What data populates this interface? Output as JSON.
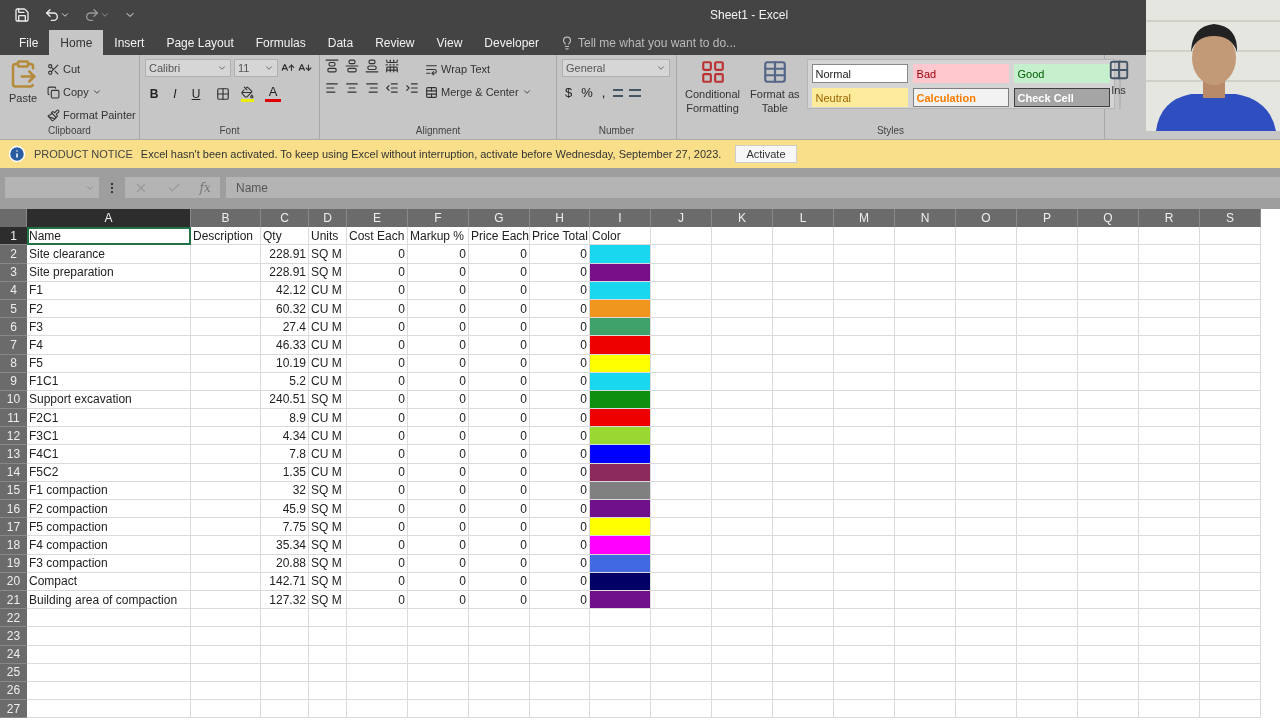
{
  "window": {
    "title": "Sheet1 - Excel"
  },
  "tabs": [
    {
      "label": "File",
      "selected": false
    },
    {
      "label": "Home",
      "selected": true
    },
    {
      "label": "Insert",
      "selected": false
    },
    {
      "label": "Page Layout",
      "selected": false
    },
    {
      "label": "Formulas",
      "selected": false
    },
    {
      "label": "Data",
      "selected": false
    },
    {
      "label": "Review",
      "selected": false
    },
    {
      "label": "View",
      "selected": false
    },
    {
      "label": "Developer",
      "selected": false
    }
  ],
  "search": {
    "placeholder": "Tell me what you want to do..."
  },
  "ribbon": {
    "clipboard": {
      "label": "Clipboard",
      "paste": "Paste",
      "cut": "Cut",
      "copy": "Copy",
      "format_painter": "Format Painter"
    },
    "font": {
      "label": "Font",
      "name": "Calibri",
      "size": "11",
      "bold": "B",
      "italic": "I",
      "underline": "U",
      "font_color": "A"
    },
    "alignment": {
      "label": "Alignment",
      "wrap": "Wrap Text",
      "merge": "Merge & Center"
    },
    "number": {
      "label": "Number",
      "format": "General",
      "currency": "$",
      "percent": "%",
      "comma": ","
    },
    "styles": {
      "label": "Styles",
      "conditional": [
        "Conditional",
        "Formatting"
      ],
      "format_table": [
        "Format as",
        "Table"
      ],
      "gallery": [
        {
          "label": "Normal",
          "kind": "normal"
        },
        {
          "label": "Bad",
          "kind": "bad"
        },
        {
          "label": "Good",
          "kind": "good"
        },
        {
          "label": "Neutral",
          "kind": "neutral"
        },
        {
          "label": "Calculation",
          "kind": "calculation"
        },
        {
          "label": "Check Cell",
          "kind": "check"
        }
      ]
    },
    "cells": {
      "insert": "Ins"
    }
  },
  "notice": {
    "title": "PRODUCT NOTICE",
    "message": "Excel hasn't been activated. To keep using Excel without interruption, activate before Wednesday, September 27, 2023.",
    "button": "Activate"
  },
  "formula_bar": {
    "fx_label": "fx",
    "value": "Name"
  },
  "columns": [
    {
      "label": "A",
      "selected": true
    },
    {
      "label": "B",
      "selected": false
    },
    {
      "label": "C",
      "selected": false
    },
    {
      "label": "D",
      "selected": false
    },
    {
      "label": "E",
      "selected": false
    },
    {
      "label": "F",
      "selected": false
    },
    {
      "label": "G",
      "selected": false
    },
    {
      "label": "H",
      "selected": false
    },
    {
      "label": "I",
      "selected": false
    },
    {
      "label": "J",
      "selected": false
    },
    {
      "label": "K",
      "selected": false
    },
    {
      "label": "L",
      "selected": false
    },
    {
      "label": "M",
      "selected": false
    },
    {
      "label": "N",
      "selected": false
    },
    {
      "label": "O",
      "selected": false
    },
    {
      "label": "P",
      "selected": false
    },
    {
      "label": "Q",
      "selected": false
    },
    {
      "label": "R",
      "selected": false
    },
    {
      "label": "S",
      "selected": false
    }
  ],
  "header_row": {
    "number": "1",
    "selected": true,
    "cells": [
      "Name",
      "Description",
      "Qty",
      "Units",
      "Cost Each",
      "Markup %",
      "Price Each",
      "Price Total",
      "Color"
    ]
  },
  "rows": [
    {
      "number": "2",
      "name": "Site clearance",
      "qty": "228.91",
      "units": "SQ M",
      "cost": "0",
      "markup": "0",
      "price_each": "0",
      "price_total": "0",
      "color": "#1ad7f0"
    },
    {
      "number": "3",
      "name": "Site preparation",
      "qty": "228.91",
      "units": "SQ M",
      "cost": "0",
      "markup": "0",
      "price_each": "0",
      "price_total": "0",
      "color": "#760f88"
    },
    {
      "number": "4",
      "name": "F1",
      "qty": "42.12",
      "units": "CU M",
      "cost": "0",
      "markup": "0",
      "price_each": "0",
      "price_total": "0",
      "color": "#1ad7f0"
    },
    {
      "number": "5",
      "name": "F2",
      "qty": "60.32",
      "units": "CU M",
      "cost": "0",
      "markup": "0",
      "price_each": "0",
      "price_total": "0",
      "color": "#f0961e"
    },
    {
      "number": "6",
      "name": "F3",
      "qty": "27.4",
      "units": "CU M",
      "cost": "0",
      "markup": "0",
      "price_each": "0",
      "price_total": "0",
      "color": "#3fa26a"
    },
    {
      "number": "7",
      "name": "F4",
      "qty": "46.33",
      "units": "CU M",
      "cost": "0",
      "markup": "0",
      "price_each": "0",
      "price_total": "0",
      "color": "#ee0000"
    },
    {
      "number": "8",
      "name": "F5",
      "qty": "10.19",
      "units": "CU M",
      "cost": "0",
      "markup": "0",
      "price_each": "0",
      "price_total": "0",
      "color": "#ffff00"
    },
    {
      "number": "9",
      "name": "F1C1",
      "qty": "5.2",
      "units": "CU M",
      "cost": "0",
      "markup": "0",
      "price_each": "0",
      "price_total": "0",
      "color": "#1ad7f0"
    },
    {
      "number": "10",
      "name": "Support excavation",
      "qty": "240.51",
      "units": "SQ M",
      "cost": "0",
      "markup": "0",
      "price_each": "0",
      "price_total": "0",
      "color": "#0f8f10"
    },
    {
      "number": "11",
      "name": "F2C1",
      "qty": "8.9",
      "units": "CU M",
      "cost": "0",
      "markup": "0",
      "price_each": "0",
      "price_total": "0",
      "color": "#ee0000"
    },
    {
      "number": "12",
      "name": "F3C1",
      "qty": "4.34",
      "units": "CU M",
      "cost": "0",
      "markup": "0",
      "price_each": "0",
      "price_total": "0",
      "color": "#98d830"
    },
    {
      "number": "13",
      "name": "F4C1",
      "qty": "7.8",
      "units": "CU M",
      "cost": "0",
      "markup": "0",
      "price_each": "0",
      "price_total": "0",
      "color": "#0000ff"
    },
    {
      "number": "14",
      "name": "F5C2",
      "qty": "1.35",
      "units": "CU M",
      "cost": "0",
      "markup": "0",
      "price_each": "0",
      "price_total": "0",
      "color": "#8c2a5e"
    },
    {
      "number": "15",
      "name": "F1 compaction",
      "qty": "32",
      "units": "SQ M",
      "cost": "0",
      "markup": "0",
      "price_each": "0",
      "price_total": "0",
      "color": "#808080"
    },
    {
      "number": "16",
      "name": "F2 compaction",
      "qty": "45.9",
      "units": "SQ M",
      "cost": "0",
      "markup": "0",
      "price_each": "0",
      "price_total": "0",
      "color": "#70108a"
    },
    {
      "number": "17",
      "name": "F5 compaction",
      "qty": "7.75",
      "units": "SQ M",
      "cost": "0",
      "markup": "0",
      "price_each": "0",
      "price_total": "0",
      "color": "#ffff00"
    },
    {
      "number": "18",
      "name": "F4 compaction",
      "qty": "35.34",
      "units": "SQ M",
      "cost": "0",
      "markup": "0",
      "price_each": "0",
      "price_total": "0",
      "color": "#ff00ff"
    },
    {
      "number": "19",
      "name": "F3 compaction",
      "qty": "20.88",
      "units": "SQ M",
      "cost": "0",
      "markup": "0",
      "price_each": "0",
      "price_total": "0",
      "color": "#4169e1"
    },
    {
      "number": "20",
      "name": "Compact",
      "qty": "142.71",
      "units": "SQ M",
      "cost": "0",
      "markup": "0",
      "price_each": "0",
      "price_total": "0",
      "color": "#000066"
    },
    {
      "number": "21",
      "name": "Building area of compaction",
      "qty": "127.32",
      "units": "SQ M",
      "cost": "0",
      "markup": "0",
      "price_each": "0",
      "price_total": "0",
      "color": "#70108a"
    }
  ],
  "empty_rows": [
    "22",
    "23",
    "24",
    "25",
    "26",
    "27"
  ]
}
